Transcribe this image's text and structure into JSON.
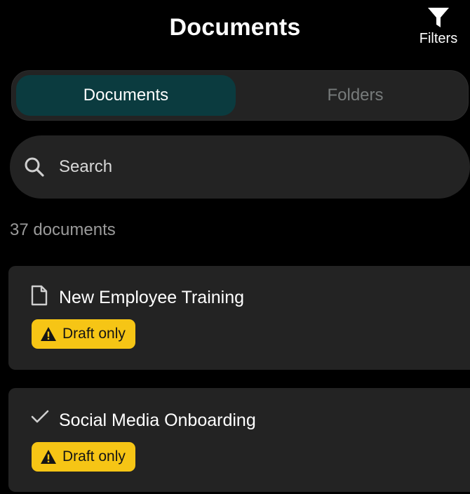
{
  "header": {
    "title": "Documents",
    "filters_label": "Filters",
    "filters_icon": "funnel-icon"
  },
  "segmented_control": {
    "options": [
      {
        "label": "Documents",
        "selected": true
      },
      {
        "label": "Folders",
        "selected": false
      }
    ]
  },
  "search": {
    "placeholder": "Search",
    "value": "",
    "icon": "search-icon"
  },
  "document_count": "37 documents",
  "documents": [
    {
      "title": "New Employee Training",
      "icon": "document-icon",
      "badge": "Draft only",
      "badge_icon": "warning-icon"
    },
    {
      "title": "Social Media Onboarding",
      "icon": "checkmark-icon",
      "badge": "Draft only",
      "badge_icon": "warning-icon"
    }
  ],
  "colors": {
    "background": "#000000",
    "surface": "#232323",
    "segment_active": "#0b3b3f",
    "badge": "#f6c515"
  }
}
